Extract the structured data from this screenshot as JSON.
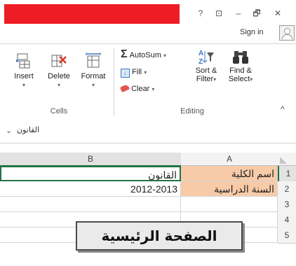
{
  "window": {
    "controls": {
      "help": "?",
      "ribbon_display": "⊡",
      "minimize": "–",
      "restore": "🗗",
      "close": "✕"
    },
    "sign_in": "Sign in"
  },
  "ribbon": {
    "cells_group": {
      "label": "Cells",
      "buttons": {
        "insert": "Insert",
        "delete": "Delete",
        "format": "Format"
      }
    },
    "editing_group": {
      "label": "Editing",
      "autosum": "AutoSum",
      "fill": "Fill",
      "clear": "Clear",
      "sort_filter_line1": "Sort &",
      "sort_filter_line2": "Filter",
      "find_select_line1": "Find &",
      "find_select_line2": "Select"
    },
    "collapse_glyph": "^"
  },
  "formula_bar": {
    "value": "القانون"
  },
  "sheet": {
    "columns": [
      "B",
      "A"
    ],
    "rows": [
      {
        "num": "1",
        "a": "اسم الكلية",
        "b": "القانون"
      },
      {
        "num": "2",
        "a": "السنة الدراسية",
        "b": "2012-2013"
      },
      {
        "num": "3",
        "a": "",
        "b": ""
      },
      {
        "num": "4",
        "a": "",
        "b": ""
      },
      {
        "num": "5",
        "a": "",
        "b": ""
      }
    ]
  },
  "home_button": {
    "label": "الصفحة الرئيسية"
  },
  "colors": {
    "title_redaction": "#ee1c24",
    "header_highlight": "#f8cba8",
    "selection": "#217346"
  }
}
